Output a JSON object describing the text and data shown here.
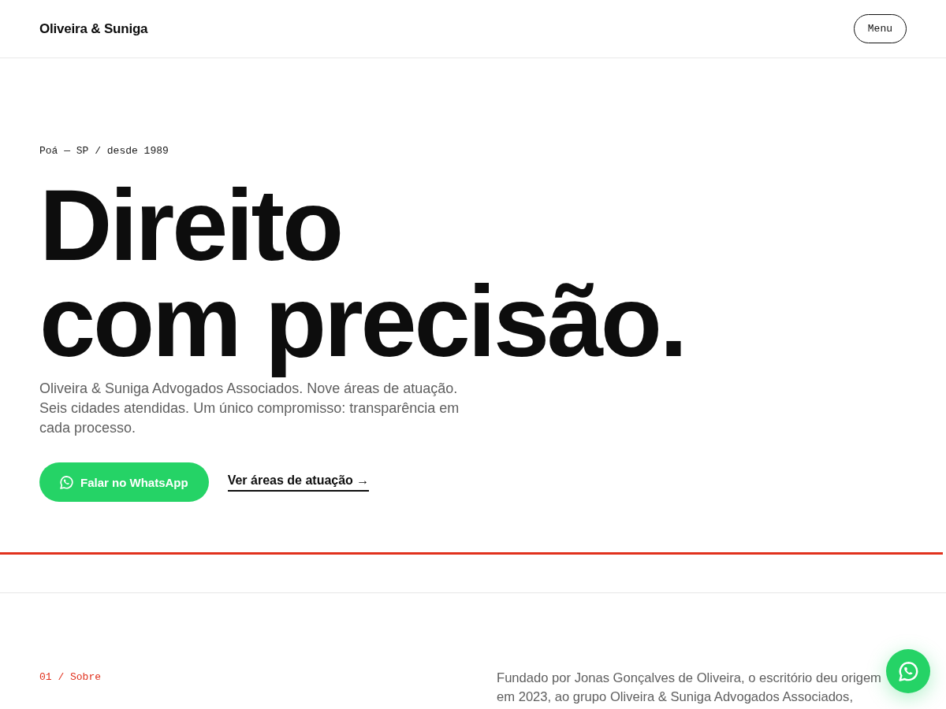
{
  "header": {
    "logo": "Oliveira & Suniga",
    "menu_button": "Menu"
  },
  "hero": {
    "eyebrow": "Poá — SP / desde 1989",
    "heading_lines": [
      "Direito",
      "com precisão."
    ],
    "lead": "Oliveira & Suniga Advogados Associados. Nove áreas de atuação. Seis cidades atendidas. Um único compromisso: transparência em cada processo.",
    "primary_button": "Falar no WhatsApp",
    "secondary_link": "Ver áreas de atuação →"
  },
  "about": {
    "label": "01 / Sobre",
    "text_lines": [
      "Fundado por Jonas Gonçalves de Oliveira, o escritório deu origem",
      "em 2023, ao grupo Oliveira & Suniga Advogados Associados,"
    ]
  }
}
